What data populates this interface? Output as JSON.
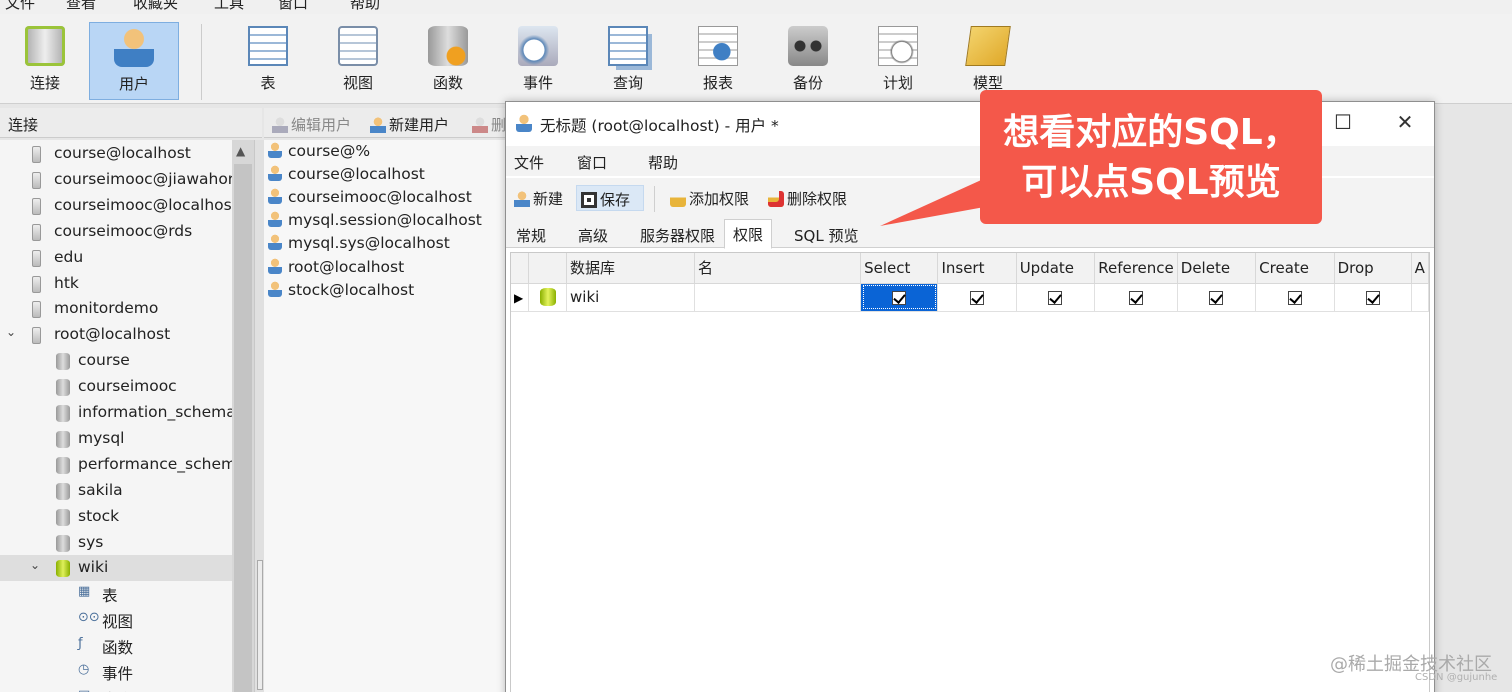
{
  "menubar": [
    "文件",
    "查看",
    "收藏夹",
    "工具",
    "窗口",
    "帮助"
  ],
  "toolbar": [
    {
      "label": "连接",
      "icon": "connection-icon"
    },
    {
      "label": "用户",
      "icon": "user-icon",
      "active": true
    },
    {
      "label": "表",
      "icon": "table-icon"
    },
    {
      "label": "视图",
      "icon": "view-icon"
    },
    {
      "label": "函数",
      "icon": "function-icon"
    },
    {
      "label": "事件",
      "icon": "event-icon"
    },
    {
      "label": "查询",
      "icon": "query-icon"
    },
    {
      "label": "报表",
      "icon": "report-icon"
    },
    {
      "label": "备份",
      "icon": "backup-icon"
    },
    {
      "label": "计划",
      "icon": "schedule-icon"
    },
    {
      "label": "模型",
      "icon": "model-icon"
    }
  ],
  "left_panel": {
    "header": "连接",
    "tree": [
      {
        "text": "course@localhost",
        "level": 0,
        "type": "conn"
      },
      {
        "text": "courseimooc@jiawahor",
        "level": 0,
        "type": "conn"
      },
      {
        "text": "courseimooc@localhos",
        "level": 0,
        "type": "conn"
      },
      {
        "text": "courseimooc@rds",
        "level": 0,
        "type": "conn"
      },
      {
        "text": "edu",
        "level": 0,
        "type": "conn"
      },
      {
        "text": "htk",
        "level": 0,
        "type": "conn"
      },
      {
        "text": "monitordemo",
        "level": 0,
        "type": "conn"
      },
      {
        "text": "root@localhost",
        "level": 0,
        "type": "conn-open",
        "expanded": true
      },
      {
        "text": "course",
        "level": 1,
        "type": "db"
      },
      {
        "text": "courseimooc",
        "level": 1,
        "type": "db"
      },
      {
        "text": "information_schema",
        "level": 1,
        "type": "db"
      },
      {
        "text": "mysql",
        "level": 1,
        "type": "db"
      },
      {
        "text": "performance_schem",
        "level": 1,
        "type": "db"
      },
      {
        "text": "sakila",
        "level": 1,
        "type": "db"
      },
      {
        "text": "stock",
        "level": 1,
        "type": "db"
      },
      {
        "text": "sys",
        "level": 1,
        "type": "db"
      },
      {
        "text": "wiki",
        "level": 1,
        "type": "db-open",
        "expanded": true,
        "selected": true
      },
      {
        "text": "表",
        "level": 2,
        "type": "table"
      },
      {
        "text": "视图",
        "level": 2,
        "type": "view"
      },
      {
        "text": "函数",
        "level": 2,
        "type": "function"
      },
      {
        "text": "事件",
        "level": 2,
        "type": "event"
      },
      {
        "text": "查询",
        "level": 2,
        "type": "query"
      }
    ]
  },
  "user_panel": {
    "toolbar": [
      "编辑用户",
      "新建用户",
      "删"
    ],
    "users": [
      "course@%",
      "course@localhost",
      "courseimooc@localhost",
      "mysql.session@localhost",
      "mysql.sys@localhost",
      "root@localhost",
      "stock@localhost"
    ]
  },
  "dialog": {
    "title": "无标题 (root@localhost) - 用户 *",
    "menu": [
      "文件",
      "窗口",
      "帮助"
    ],
    "tools": [
      "新建",
      "保存",
      "添加权限",
      "删除权限"
    ],
    "tabs": [
      "常规",
      "高级",
      "服务器权限",
      "权限",
      "SQL 预览"
    ],
    "active_tab": "权限",
    "grid": {
      "columns": [
        "数据库",
        "名",
        "Select",
        "Insert",
        "Update",
        "Reference",
        "Delete",
        "Create",
        "Drop",
        "A"
      ],
      "rows": [
        {
          "database": "wiki",
          "name": "",
          "select": true,
          "insert": true,
          "update": true,
          "reference": true,
          "delete": true,
          "create": true,
          "drop": true
        }
      ]
    }
  },
  "callout": {
    "line1": "想看对应的SQL，",
    "line2": "可以点SQL预览",
    "color": "#f4584a"
  },
  "watermark": {
    "main": "@稀土掘金技术社区",
    "sub": "CSDN @gujunhe"
  },
  "colors": {
    "selection": "#0a64d6",
    "active_tool": "#b9d6f5"
  }
}
